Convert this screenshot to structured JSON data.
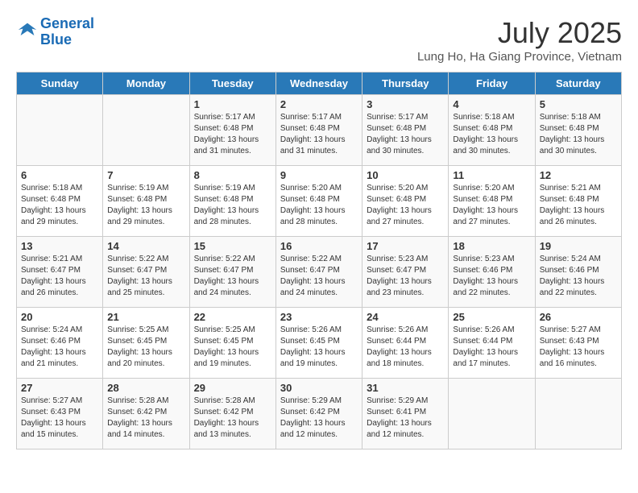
{
  "logo": {
    "line1": "General",
    "line2": "Blue"
  },
  "title": "July 2025",
  "subtitle": "Lung Ho, Ha Giang Province, Vietnam",
  "days_of_week": [
    "Sunday",
    "Monday",
    "Tuesday",
    "Wednesday",
    "Thursday",
    "Friday",
    "Saturday"
  ],
  "weeks": [
    [
      {
        "day": "",
        "info": ""
      },
      {
        "day": "",
        "info": ""
      },
      {
        "day": "1",
        "info": "Sunrise: 5:17 AM\nSunset: 6:48 PM\nDaylight: 13 hours and 31 minutes."
      },
      {
        "day": "2",
        "info": "Sunrise: 5:17 AM\nSunset: 6:48 PM\nDaylight: 13 hours and 31 minutes."
      },
      {
        "day": "3",
        "info": "Sunrise: 5:17 AM\nSunset: 6:48 PM\nDaylight: 13 hours and 30 minutes."
      },
      {
        "day": "4",
        "info": "Sunrise: 5:18 AM\nSunset: 6:48 PM\nDaylight: 13 hours and 30 minutes."
      },
      {
        "day": "5",
        "info": "Sunrise: 5:18 AM\nSunset: 6:48 PM\nDaylight: 13 hours and 30 minutes."
      }
    ],
    [
      {
        "day": "6",
        "info": "Sunrise: 5:18 AM\nSunset: 6:48 PM\nDaylight: 13 hours and 29 minutes."
      },
      {
        "day": "7",
        "info": "Sunrise: 5:19 AM\nSunset: 6:48 PM\nDaylight: 13 hours and 29 minutes."
      },
      {
        "day": "8",
        "info": "Sunrise: 5:19 AM\nSunset: 6:48 PM\nDaylight: 13 hours and 28 minutes."
      },
      {
        "day": "9",
        "info": "Sunrise: 5:20 AM\nSunset: 6:48 PM\nDaylight: 13 hours and 28 minutes."
      },
      {
        "day": "10",
        "info": "Sunrise: 5:20 AM\nSunset: 6:48 PM\nDaylight: 13 hours and 27 minutes."
      },
      {
        "day": "11",
        "info": "Sunrise: 5:20 AM\nSunset: 6:48 PM\nDaylight: 13 hours and 27 minutes."
      },
      {
        "day": "12",
        "info": "Sunrise: 5:21 AM\nSunset: 6:48 PM\nDaylight: 13 hours and 26 minutes."
      }
    ],
    [
      {
        "day": "13",
        "info": "Sunrise: 5:21 AM\nSunset: 6:47 PM\nDaylight: 13 hours and 26 minutes."
      },
      {
        "day": "14",
        "info": "Sunrise: 5:22 AM\nSunset: 6:47 PM\nDaylight: 13 hours and 25 minutes."
      },
      {
        "day": "15",
        "info": "Sunrise: 5:22 AM\nSunset: 6:47 PM\nDaylight: 13 hours and 24 minutes."
      },
      {
        "day": "16",
        "info": "Sunrise: 5:22 AM\nSunset: 6:47 PM\nDaylight: 13 hours and 24 minutes."
      },
      {
        "day": "17",
        "info": "Sunrise: 5:23 AM\nSunset: 6:47 PM\nDaylight: 13 hours and 23 minutes."
      },
      {
        "day": "18",
        "info": "Sunrise: 5:23 AM\nSunset: 6:46 PM\nDaylight: 13 hours and 22 minutes."
      },
      {
        "day": "19",
        "info": "Sunrise: 5:24 AM\nSunset: 6:46 PM\nDaylight: 13 hours and 22 minutes."
      }
    ],
    [
      {
        "day": "20",
        "info": "Sunrise: 5:24 AM\nSunset: 6:46 PM\nDaylight: 13 hours and 21 minutes."
      },
      {
        "day": "21",
        "info": "Sunrise: 5:25 AM\nSunset: 6:45 PM\nDaylight: 13 hours and 20 minutes."
      },
      {
        "day": "22",
        "info": "Sunrise: 5:25 AM\nSunset: 6:45 PM\nDaylight: 13 hours and 19 minutes."
      },
      {
        "day": "23",
        "info": "Sunrise: 5:26 AM\nSunset: 6:45 PM\nDaylight: 13 hours and 19 minutes."
      },
      {
        "day": "24",
        "info": "Sunrise: 5:26 AM\nSunset: 6:44 PM\nDaylight: 13 hours and 18 minutes."
      },
      {
        "day": "25",
        "info": "Sunrise: 5:26 AM\nSunset: 6:44 PM\nDaylight: 13 hours and 17 minutes."
      },
      {
        "day": "26",
        "info": "Sunrise: 5:27 AM\nSunset: 6:43 PM\nDaylight: 13 hours and 16 minutes."
      }
    ],
    [
      {
        "day": "27",
        "info": "Sunrise: 5:27 AM\nSunset: 6:43 PM\nDaylight: 13 hours and 15 minutes."
      },
      {
        "day": "28",
        "info": "Sunrise: 5:28 AM\nSunset: 6:42 PM\nDaylight: 13 hours and 14 minutes."
      },
      {
        "day": "29",
        "info": "Sunrise: 5:28 AM\nSunset: 6:42 PM\nDaylight: 13 hours and 13 minutes."
      },
      {
        "day": "30",
        "info": "Sunrise: 5:29 AM\nSunset: 6:42 PM\nDaylight: 13 hours and 12 minutes."
      },
      {
        "day": "31",
        "info": "Sunrise: 5:29 AM\nSunset: 6:41 PM\nDaylight: 13 hours and 12 minutes."
      },
      {
        "day": "",
        "info": ""
      },
      {
        "day": "",
        "info": ""
      }
    ]
  ]
}
